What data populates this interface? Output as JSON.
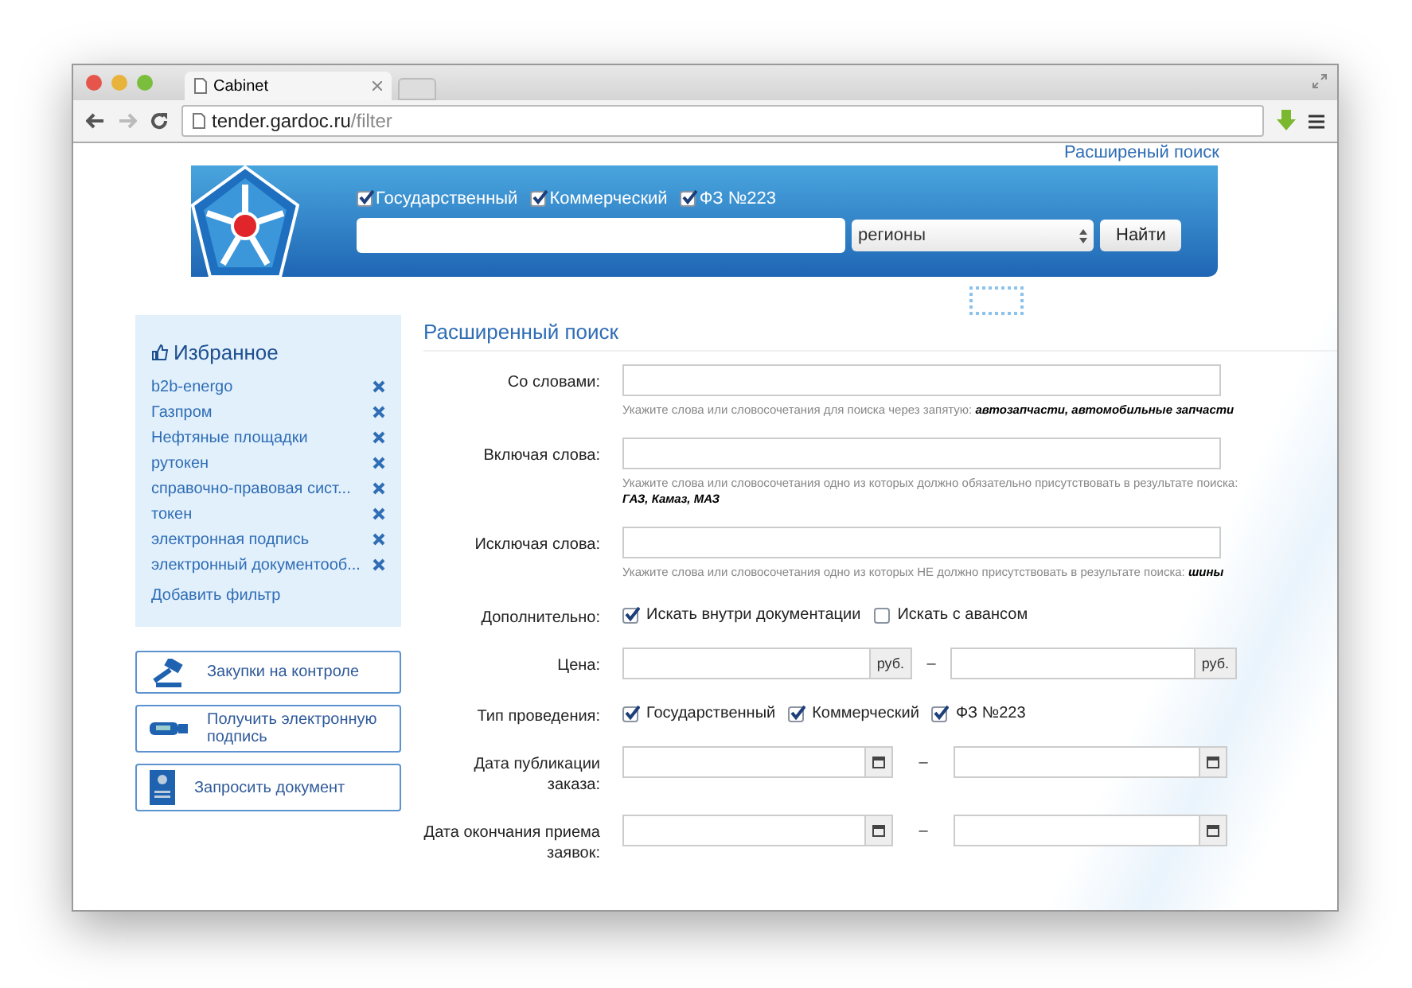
{
  "browser": {
    "tab_title": "Cabinet",
    "url_host": "tender.gardoc.ru",
    "url_path": "/filter"
  },
  "header": {
    "advanced_link": "Расширеный поиск",
    "types": [
      {
        "label": "Государственный",
        "checked": true
      },
      {
        "label": "Коммерческий",
        "checked": true
      },
      {
        "label": "ФЗ №223",
        "checked": true
      }
    ],
    "region_select": "регионы",
    "search_button": "Найти"
  },
  "favorites": {
    "title": "Избранное",
    "items": [
      {
        "label": "b2b-energo"
      },
      {
        "label": "Газпром"
      },
      {
        "label": "Нефтяные площадки"
      },
      {
        "label": "рутокен"
      },
      {
        "label": "справочно-правовая сист..."
      },
      {
        "label": "токен"
      },
      {
        "label": "электронная подпись"
      },
      {
        "label": "электронный документооб..."
      }
    ],
    "add_filter": "Добавить фильтр"
  },
  "side_buttons": [
    {
      "kind": "gavel",
      "label": "Закупки на контроле"
    },
    {
      "kind": "usb",
      "label": "Получить электронную подпись"
    },
    {
      "kind": "document",
      "label": "Запросить документ"
    }
  ],
  "form": {
    "title": "Расширенный поиск",
    "rows": [
      {
        "kind": "text",
        "label": "Со словами:",
        "hint": "Укажите слова или словосочетания для поиска через запятую: *автозапчасти, автомобильные запчасти*"
      },
      {
        "kind": "text",
        "label": "Включая слова:",
        "hint": "Укажите слова или словосочетания одно из которых должно обязательно присутствовать в результате поиска: *ГАЗ, Камаз, МАЗ*"
      },
      {
        "kind": "text",
        "label": "Исключая слова:",
        "hint": "Укажите слова или словосочетания одно из которых НЕ должно присутствовать в результате поиска: *шины*"
      },
      {
        "kind": "checks",
        "label": "Дополнительно:",
        "options": [
          {
            "label": "Искать внутри документации",
            "checked": true
          },
          {
            "label": "Искать с авансом",
            "checked": false
          }
        ]
      },
      {
        "kind": "range",
        "label": "Цена:",
        "unit": "руб.",
        "unit_2": "руб.",
        "separator": "–"
      },
      {
        "kind": "checks",
        "label": "Тип проведения:",
        "options": [
          {
            "label": "Государственный",
            "checked": true
          },
          {
            "label": "Коммерческий",
            "checked": true
          },
          {
            "label": "ФЗ №223",
            "checked": true
          }
        ]
      },
      {
        "kind": "dates",
        "label": "Дата публикации заказа:",
        "separator": "–"
      },
      {
        "kind": "dates",
        "label": "Дата окончания приема заявок:",
        "separator": "–"
      }
    ]
  }
}
